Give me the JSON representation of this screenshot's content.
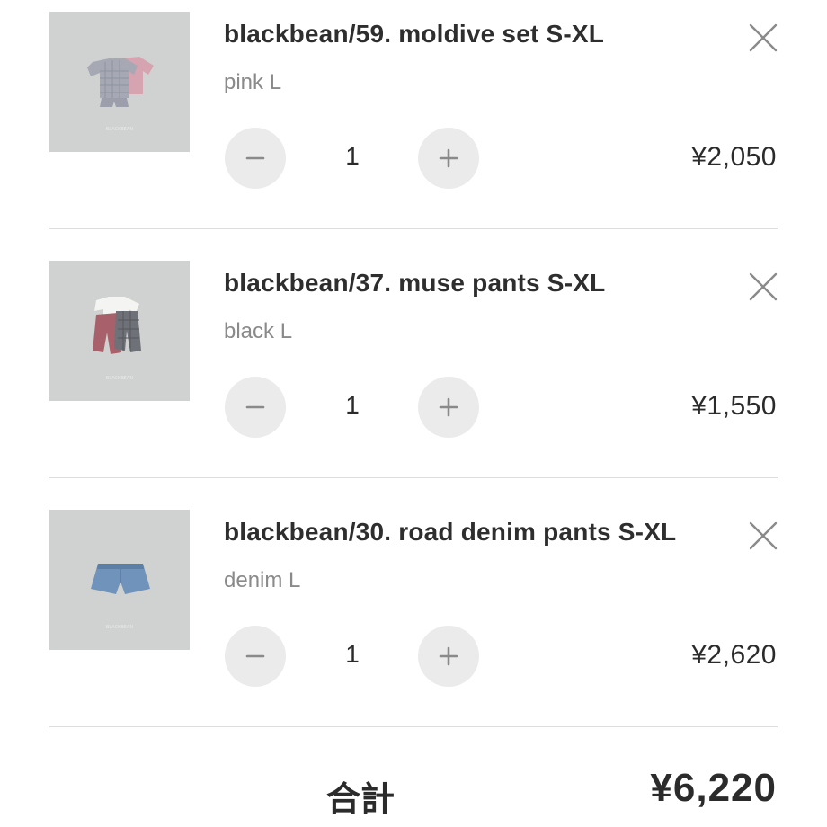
{
  "cart": {
    "items": [
      {
        "title": "blackbean/59. moldive set S-XL",
        "variant": "pink L",
        "quantity": "1",
        "price": "¥2,050",
        "thumb_watermark": "BLACKBEAN"
      },
      {
        "title": "blackbean/37. muse pants S-XL",
        "variant": "black L",
        "quantity": "1",
        "price": "¥1,550",
        "thumb_watermark": "BLACKBEAN"
      },
      {
        "title": "blackbean/30. road denim pants S-XL",
        "variant": "denim L",
        "quantity": "1",
        "price": "¥2,620",
        "thumb_watermark": "BLACKBEAN"
      }
    ],
    "icons": {
      "remove": "close-icon",
      "decrease": "minus-icon",
      "increase": "plus-icon"
    },
    "summary": {
      "total_label": "合計",
      "total_value": "¥6,220"
    }
  },
  "colors": {
    "stepper_bg": "#ebebeb",
    "thumb_bg": "#cfd2d0",
    "muted_text": "#8a8a8a",
    "divider": "#dddddd"
  }
}
